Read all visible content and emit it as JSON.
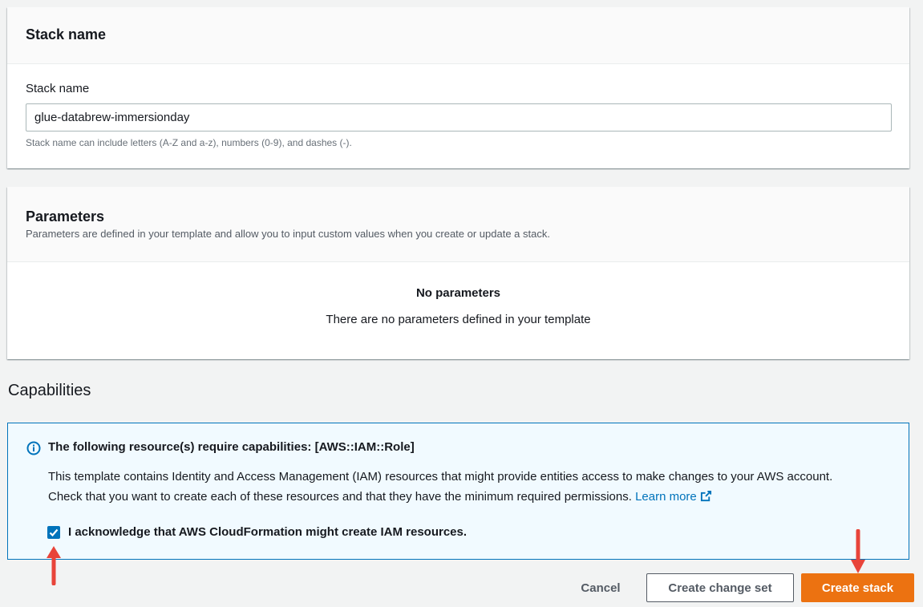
{
  "stack_section": {
    "title": "Stack name",
    "field_label": "Stack name",
    "field_value": "glue-databrew-immersionday",
    "hint": "Stack name can include letters (A-Z and a-z), numbers (0-9), and dashes (-)."
  },
  "parameters_section": {
    "title": "Parameters",
    "description": "Parameters are defined in your template and allow you to input custom values when you create or update a stack.",
    "empty_title": "No parameters",
    "empty_description": "There are no parameters defined in your template"
  },
  "capabilities": {
    "heading": "Capabilities",
    "alert": {
      "icon": "info-icon",
      "title": "The following resource(s) require capabilities: [AWS::IAM::Role]",
      "body_line1": "This template contains Identity and Access Management (IAM) resources that might provide entities access to make changes to your AWS account.",
      "body_line2": "Check that you want to create each of these resources and that they have the minimum required permissions.",
      "link_text": "Learn more",
      "link_icon": "external-link-icon"
    },
    "acknowledge_checked": true,
    "acknowledge_label": "I acknowledge that AWS CloudFormation might create IAM resources."
  },
  "actions": {
    "cancel": "Cancel",
    "create_change_set": "Create change set",
    "create_stack": "Create stack"
  },
  "colors": {
    "primary": "#ec7211",
    "link": "#0073bb",
    "annotation_arrow": "#e8443a"
  }
}
